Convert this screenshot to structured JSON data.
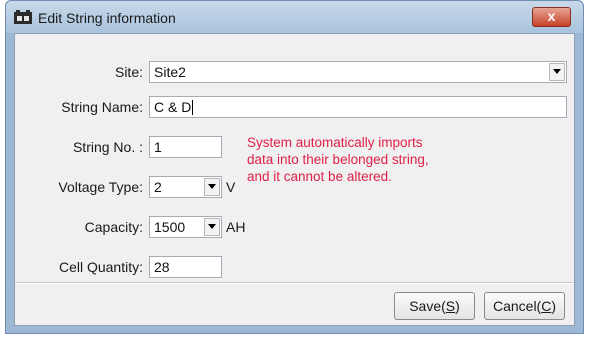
{
  "window": {
    "title": "Edit String information",
    "close_glyph": "x"
  },
  "form": {
    "site": {
      "label": "Site:",
      "value": "Site2"
    },
    "string_name": {
      "label": "String Name:",
      "value": "C & D"
    },
    "string_no": {
      "label": "String No. :",
      "value": "1"
    },
    "voltage_type": {
      "label": "Voltage Type:",
      "value": "2",
      "unit": "V"
    },
    "capacity": {
      "label": "Capacity:",
      "value": "1500",
      "unit": "AH"
    },
    "cell_quantity": {
      "label": "Cell Quantity:",
      "value": "28"
    },
    "note_lines": [
      "System automatically imports",
      "data into their belonged string,",
      "and it cannot be altered."
    ],
    "note_color": "#e0204a"
  },
  "buttons": {
    "save": {
      "text": "Save(",
      "mnemonic": "S",
      "close": ")"
    },
    "cancel": {
      "text": "Cancel(",
      "mnemonic": "C",
      "close": ")"
    }
  },
  "icons": {
    "app": "database-icon",
    "close": "close-icon",
    "dropdown": "chevron-down-icon"
  }
}
